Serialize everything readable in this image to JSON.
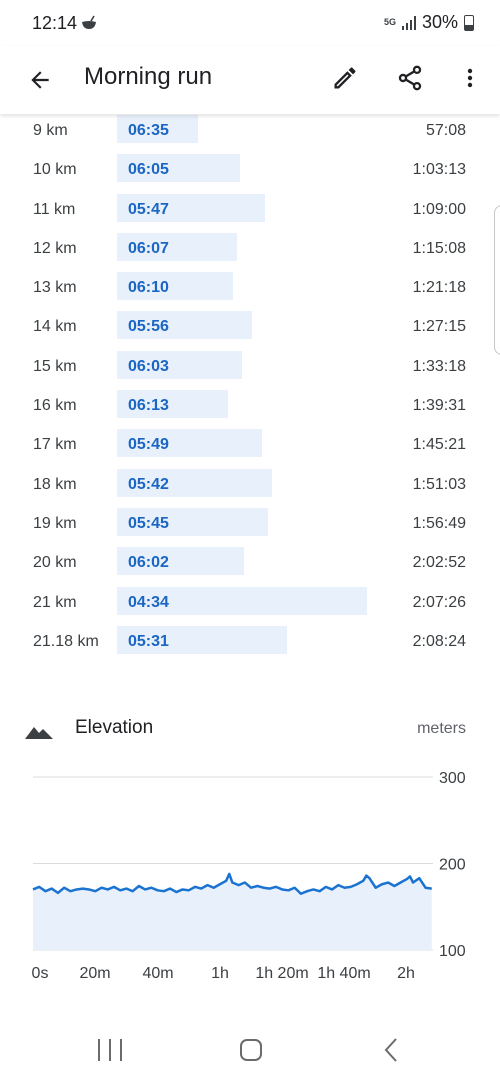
{
  "status_bar": {
    "time": "12:14",
    "network": "5G",
    "battery": "30%"
  },
  "app_bar": {
    "title": "Morning run",
    "icons": [
      "back-arrow-icon",
      "edit-pencil-icon",
      "share-icon",
      "more-vert-icon"
    ]
  },
  "splits": [
    {
      "distance": "9 km",
      "pace": "06:35",
      "time": "57:08"
    },
    {
      "distance": "10 km",
      "pace": "06:05",
      "time": "1:03:13"
    },
    {
      "distance": "11 km",
      "pace": "05:47",
      "time": "1:09:00"
    },
    {
      "distance": "12 km",
      "pace": "06:07",
      "time": "1:15:08"
    },
    {
      "distance": "13 km",
      "pace": "06:10",
      "time": "1:21:18"
    },
    {
      "distance": "14 km",
      "pace": "05:56",
      "time": "1:27:15"
    },
    {
      "distance": "15 km",
      "pace": "06:03",
      "time": "1:33:18"
    },
    {
      "distance": "16 km",
      "pace": "06:13",
      "time": "1:39:31"
    },
    {
      "distance": "17 km",
      "pace": "05:49",
      "time": "1:45:21"
    },
    {
      "distance": "18 km",
      "pace": "05:42",
      "time": "1:51:03"
    },
    {
      "distance": "19 km",
      "pace": "05:45",
      "time": "1:56:49"
    },
    {
      "distance": "20 km",
      "pace": "06:02",
      "time": "2:02:52"
    },
    {
      "distance": "21 km",
      "pace": "04:34",
      "time": "2:07:26"
    },
    {
      "distance": "21.18 km",
      "pace": "05:31",
      "time": "2:08:24"
    }
  ],
  "elevation": {
    "title": "Elevation",
    "unit": "meters",
    "icon": "mountain-icon"
  },
  "chart_data": {
    "type": "area",
    "title": "Elevation",
    "ylabel": "meters",
    "ylim": [
      100,
      300
    ],
    "y_ticks": [
      "300",
      "200",
      "100"
    ],
    "x_ticks": [
      "0s",
      "20m",
      "40m",
      "1h",
      "1h 20m",
      "1h 40m",
      "2h"
    ],
    "x_minutes_range": [
      0,
      128.4
    ],
    "grid": true,
    "colors": {
      "line": "#1a73d1",
      "fill": "#e8f0fc",
      "grid": "#dadce0"
    },
    "x": [
      0,
      2,
      4,
      6,
      8,
      10,
      12,
      14,
      16,
      18,
      20,
      22,
      24,
      26,
      28,
      30,
      32,
      34,
      36,
      38,
      40,
      42,
      44,
      46,
      48,
      50,
      52,
      54,
      56,
      58,
      60,
      62,
      63,
      64,
      66,
      68,
      70,
      72,
      74,
      76,
      78,
      80,
      82,
      84,
      86,
      88,
      90,
      92,
      94,
      96,
      98,
      100,
      102,
      104,
      106,
      107,
      108,
      110,
      112,
      114,
      116,
      118,
      120,
      121,
      122,
      124,
      126,
      128
    ],
    "y": [
      170,
      173,
      168,
      171,
      166,
      172,
      168,
      170,
      171,
      170,
      168,
      172,
      170,
      173,
      169,
      171,
      168,
      174,
      170,
      172,
      169,
      168,
      171,
      167,
      170,
      169,
      173,
      171,
      175,
      172,
      176,
      180,
      188,
      178,
      175,
      178,
      172,
      174,
      172,
      171,
      173,
      170,
      169,
      172,
      165,
      168,
      170,
      168,
      173,
      170,
      175,
      172,
      173,
      176,
      180,
      186,
      183,
      172,
      176,
      178,
      174,
      178,
      182,
      185,
      178,
      183,
      172,
      171
    ]
  }
}
